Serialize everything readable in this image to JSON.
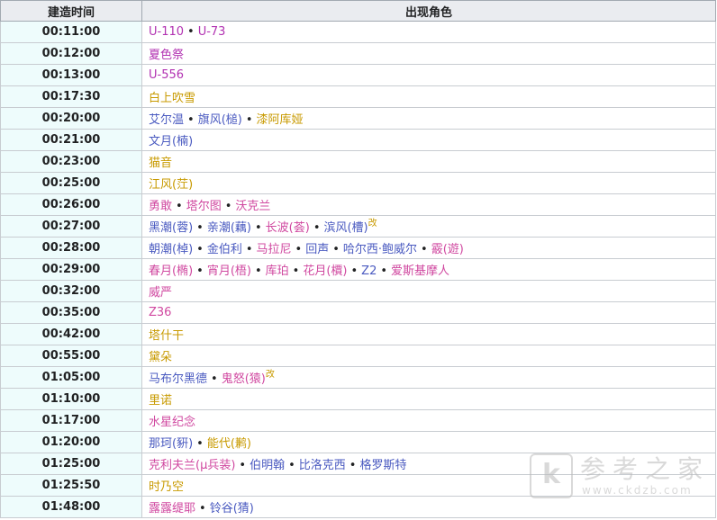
{
  "headers": {
    "time": "建造时间",
    "characters": "出现角色"
  },
  "colors": {
    "purple": "#b232b2",
    "gold": "#c89a00",
    "blue": "#4a5ac0",
    "pink": "#d048a0"
  },
  "rows": [
    {
      "time": "00:11:00",
      "chars": [
        {
          "t": "U-110",
          "c": "purple"
        },
        {
          "t": "U-73",
          "c": "purple"
        }
      ]
    },
    {
      "time": "00:12:00",
      "chars": [
        {
          "t": "夏色祭",
          "c": "purple"
        }
      ]
    },
    {
      "time": "00:13:00",
      "chars": [
        {
          "t": "U-556",
          "c": "purple"
        }
      ]
    },
    {
      "time": "00:17:30",
      "chars": [
        {
          "t": "白上吹雪",
          "c": "gold"
        }
      ]
    },
    {
      "time": "00:20:00",
      "chars": [
        {
          "t": "艾尔温",
          "c": "blue"
        },
        {
          "t": "旗风(槌)",
          "c": "blue"
        },
        {
          "t": "漆阿库娅",
          "c": "gold"
        }
      ]
    },
    {
      "time": "00:21:00",
      "chars": [
        {
          "t": "文月(楠)",
          "c": "blue"
        }
      ]
    },
    {
      "time": "00:23:00",
      "chars": [
        {
          "t": "猫音",
          "c": "gold"
        }
      ]
    },
    {
      "time": "00:25:00",
      "chars": [
        {
          "t": "江风(茳)",
          "c": "gold"
        }
      ]
    },
    {
      "time": "00:26:00",
      "chars": [
        {
          "t": "勇敢",
          "c": "pink"
        },
        {
          "t": "塔尔图",
          "c": "pink"
        },
        {
          "t": "沃克兰",
          "c": "pink"
        }
      ]
    },
    {
      "time": "00:27:00",
      "chars": [
        {
          "t": "黑潮(蓉)",
          "c": "blue"
        },
        {
          "t": "亲潮(藕)",
          "c": "blue"
        },
        {
          "t": "长波(荟)",
          "c": "pink"
        },
        {
          "t": "滨风(槽)",
          "c": "blue",
          "mark": "改"
        }
      ]
    },
    {
      "time": "00:28:00",
      "chars": [
        {
          "t": "朝潮(棹)",
          "c": "blue"
        },
        {
          "t": "金伯利",
          "c": "blue"
        },
        {
          "t": "马拉尼",
          "c": "pink"
        },
        {
          "t": "回声",
          "c": "blue"
        },
        {
          "t": "哈尔西·鲍威尔",
          "c": "blue"
        },
        {
          "t": "霰(遊)",
          "c": "pink"
        }
      ]
    },
    {
      "time": "00:29:00",
      "chars": [
        {
          "t": "春月(椭)",
          "c": "pink"
        },
        {
          "t": "宵月(梧)",
          "c": "pink"
        },
        {
          "t": "库珀",
          "c": "pink"
        },
        {
          "t": "花月(檟)",
          "c": "pink"
        },
        {
          "t": "Z2",
          "c": "blue"
        },
        {
          "t": "爱斯基摩人",
          "c": "pink"
        }
      ]
    },
    {
      "time": "00:32:00",
      "chars": [
        {
          "t": "威严",
          "c": "pink"
        }
      ]
    },
    {
      "time": "00:35:00",
      "chars": [
        {
          "t": "Z36",
          "c": "pink"
        }
      ]
    },
    {
      "time": "00:42:00",
      "chars": [
        {
          "t": "塔什干",
          "c": "gold"
        }
      ]
    },
    {
      "time": "00:55:00",
      "chars": [
        {
          "t": "黛朵",
          "c": "gold"
        }
      ]
    },
    {
      "time": "01:05:00",
      "chars": [
        {
          "t": "马布尔黑德",
          "c": "blue"
        },
        {
          "t": "鬼怒(猿)",
          "c": "pink",
          "mark": "改"
        }
      ]
    },
    {
      "time": "01:10:00",
      "chars": [
        {
          "t": "里诺",
          "c": "gold"
        }
      ]
    },
    {
      "time": "01:17:00",
      "chars": [
        {
          "t": "水星纪念",
          "c": "pink"
        }
      ]
    },
    {
      "time": "01:20:00",
      "chars": [
        {
          "t": "那珂(豣)",
          "c": "blue"
        },
        {
          "t": "能代(鹣)",
          "c": "gold"
        }
      ]
    },
    {
      "time": "01:25:00",
      "chars": [
        {
          "t": "克利夫兰(μ兵装)",
          "c": "pink"
        },
        {
          "t": "伯明翰",
          "c": "blue"
        },
        {
          "t": "比洛克西",
          "c": "blue"
        },
        {
          "t": "格罗斯特",
          "c": "blue"
        }
      ]
    },
    {
      "time": "01:25:50",
      "chars": [
        {
          "t": "时乃空",
          "c": "gold"
        }
      ]
    },
    {
      "time": "01:48:00",
      "chars": [
        {
          "t": "露露缇耶",
          "c": "pink"
        },
        {
          "t": "铃谷(猜)",
          "c": "blue"
        }
      ]
    }
  ],
  "separator": "•",
  "watermark": {
    "logo": "k",
    "title": "参考之家",
    "url": "www.ckdzb.com"
  }
}
